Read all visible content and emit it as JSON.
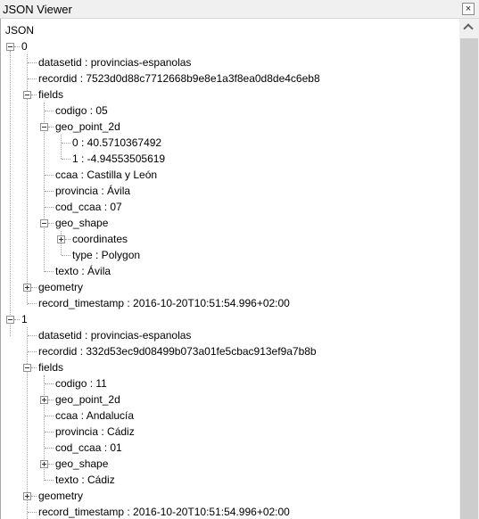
{
  "window": {
    "title": "JSON Viewer",
    "close_glyph": "×"
  },
  "tree": {
    "root_label": "JSON",
    "records": [
      {
        "index": "0",
        "datasetid": "datasetid : provincias-espanolas",
        "recordid": "recordid : 7523d0d88c7712668b9e8e1a3f8ea0d8de4c6eb8",
        "fields": "fields",
        "codigo": "codigo : 05",
        "geo_point_2d": "geo_point_2d",
        "gp0": "0 : 40.5710367492",
        "gp1": "1 : -4.94553505619",
        "ccaa": "ccaa : Castilla y León",
        "provincia": "provincia : Ávila",
        "cod_ccaa": "cod_ccaa : 07",
        "geo_shape": "geo_shape",
        "coordinates": "coordinates",
        "type": "type : Polygon",
        "texto": "texto : Ávila",
        "geometry": "geometry",
        "record_timestamp": "record_timestamp : 2016-10-20T10:51:54.996+02:00"
      },
      {
        "index": "1",
        "datasetid": "datasetid : provincias-espanolas",
        "recordid": "recordid : 332d53ec9d08499b073a01fe5cbac913ef9a7b8b",
        "fields": "fields",
        "codigo": "codigo : 11",
        "geo_point_2d": "geo_point_2d",
        "ccaa": "ccaa : Andalucía",
        "provincia": "provincia : Cádiz",
        "cod_ccaa": "cod_ccaa : 01",
        "geo_shape": "geo_shape",
        "texto": "texto : Cádiz",
        "geometry": "geometry",
        "record_timestamp": "record_timestamp : 2016-10-20T10:51:54.996+02:00"
      }
    ]
  },
  "scrollbar": {
    "up_icon": "chevron-up-icon"
  }
}
